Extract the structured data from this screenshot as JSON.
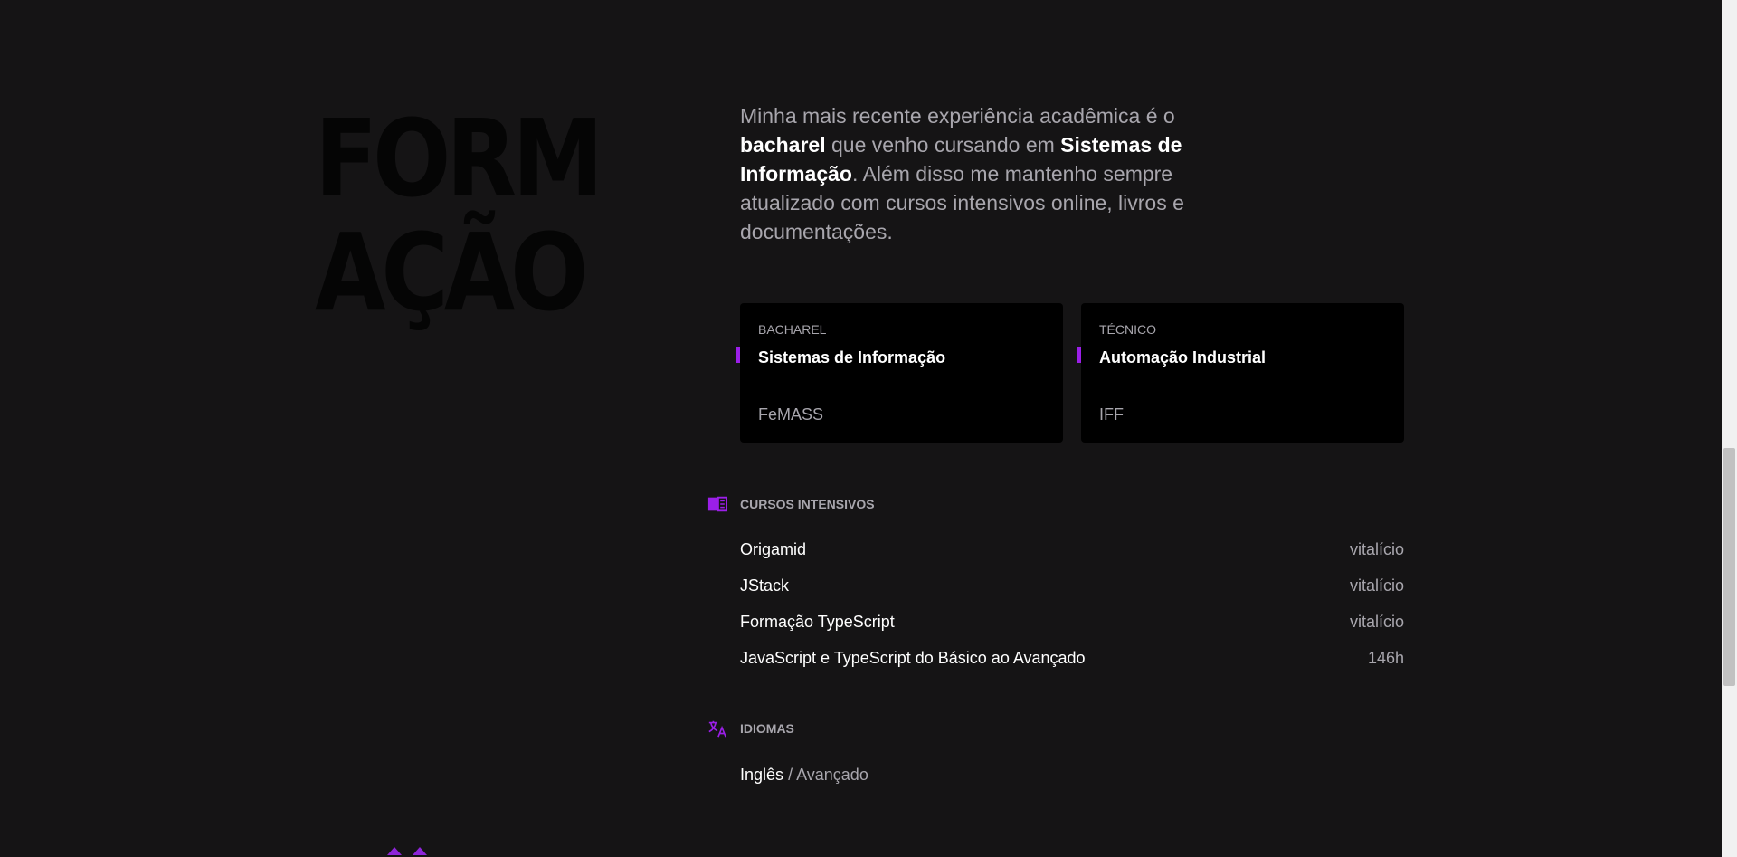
{
  "section": {
    "title_line1": "FORM",
    "title_line2": "AÇÃO"
  },
  "intro": {
    "part1": "Minha mais recente experiência acadêmica é o ",
    "strong1": "bacharel",
    "part2": " que venho cursando em ",
    "strong2": "Sistemas de Informação",
    "part3": ". Além disso me mantenho sempre atualizado com cursos intensivos online, livros e documentações."
  },
  "degrees": [
    {
      "type": "BACHAREL",
      "title": "Sistemas de Informação",
      "institution": "FeMASS"
    },
    {
      "type": "TÉCNICO",
      "title": "Automação Industrial",
      "institution": "IFF"
    }
  ],
  "courses": {
    "heading": "CURSOS INTENSIVOS",
    "icon": "book-icon",
    "items": [
      {
        "name": "Origamid",
        "duration": "vitalício"
      },
      {
        "name": "JStack",
        "duration": "vitalício"
      },
      {
        "name": "Formação TypeScript",
        "duration": "vitalício"
      },
      {
        "name": "JavaScript e TypeScript do Básico ao Avançado",
        "duration": "146h"
      }
    ]
  },
  "languages": {
    "heading": "IDIOMAS",
    "icon": "translate-icon",
    "items": [
      {
        "name": "Inglês",
        "separator": "/",
        "level": "Avançado"
      }
    ]
  },
  "colors": {
    "background": "#151415",
    "card": "#000000",
    "accent": "#9b1fe8",
    "muted_text": "#a8a6ad",
    "title_text": "#050505"
  }
}
